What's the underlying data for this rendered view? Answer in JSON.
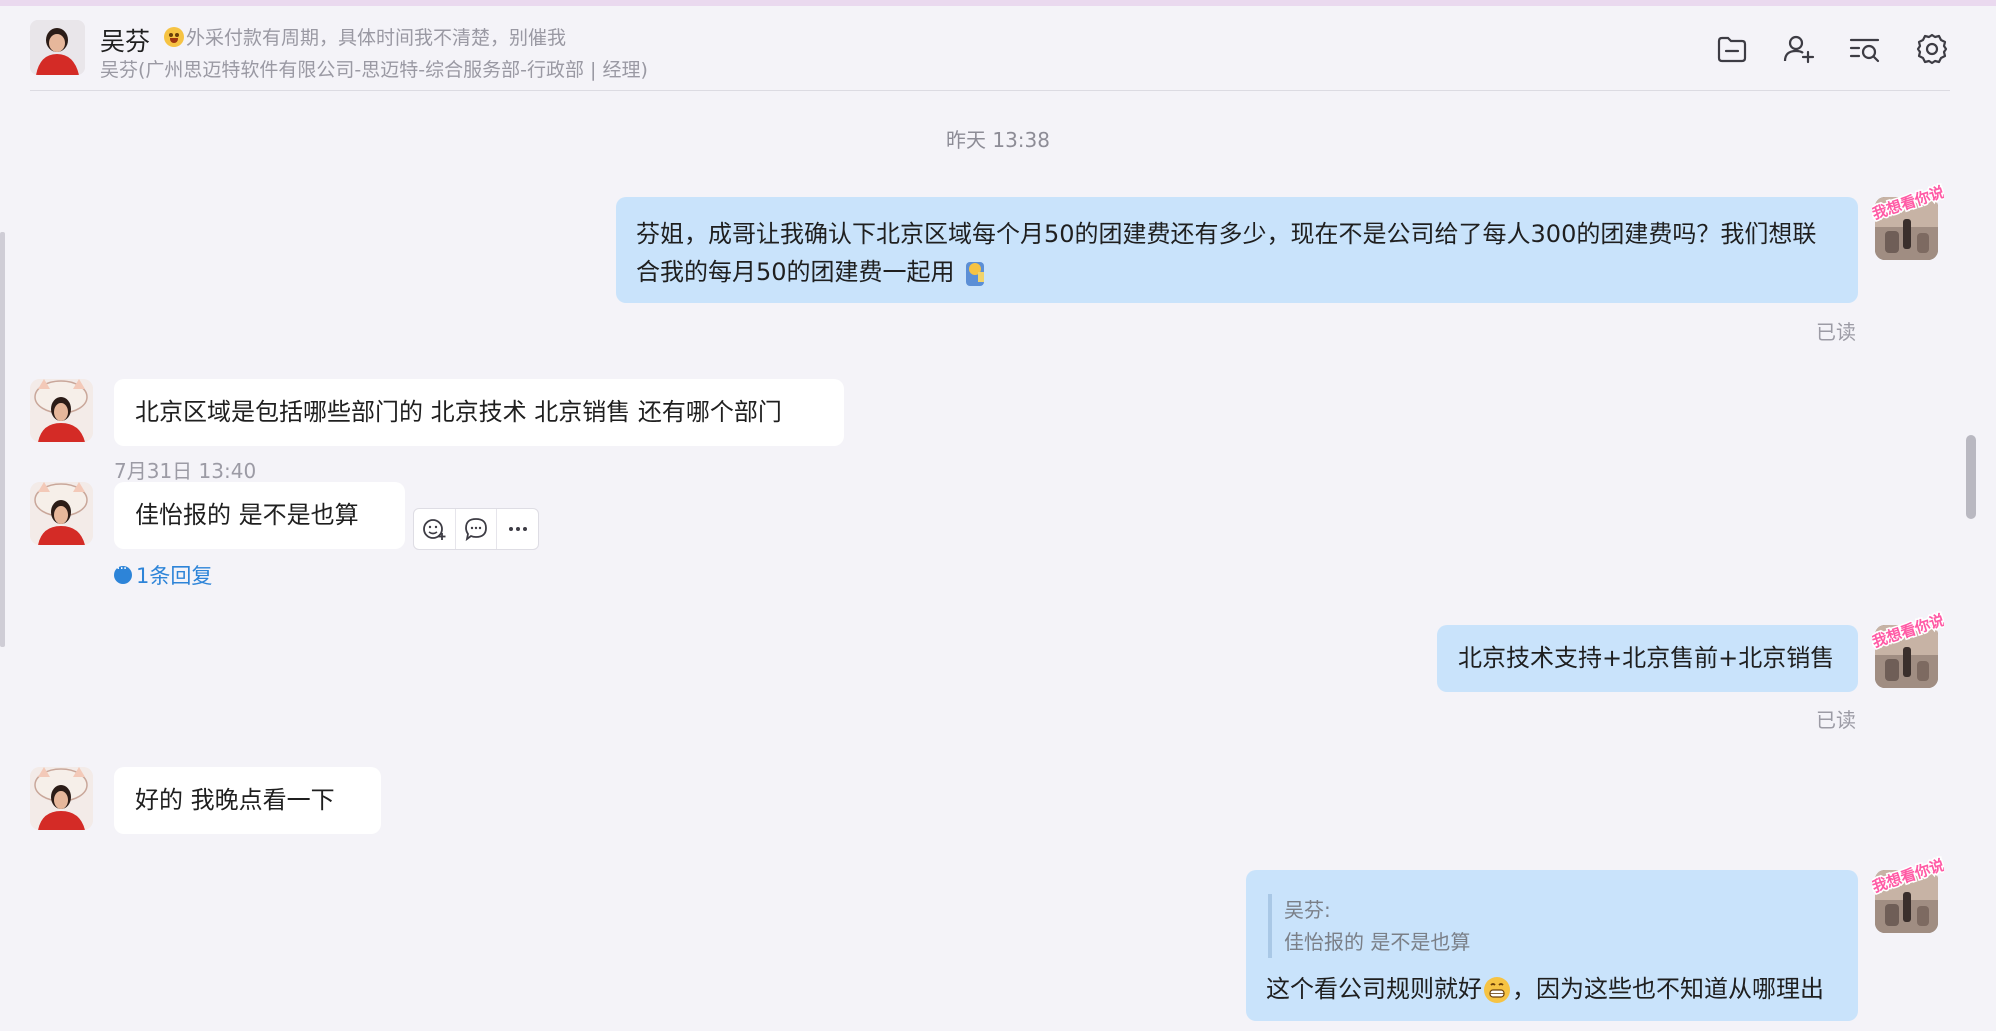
{
  "header": {
    "name": "吴芬",
    "status": "外采付款有周期，具体时间我不清楚，别催我",
    "subtitle": "吴芬(广州思迈特软件有限公司-思迈特-综合服务部-行政部 | 经理)",
    "icons": [
      "folder-icon",
      "add-user-icon",
      "search-history-icon",
      "gear-icon"
    ]
  },
  "chat": {
    "time_separator": "昨天 13:38",
    "messages": [
      {
        "from": "me",
        "text_line1": "芬姐，成哥让我确认下北京区域每个月50的团建费还有多少，现在不是公司给了每人300的团建费吗？我们想联",
        "text_line2": "合我的每月50的团建费一起用",
        "status": "已读"
      },
      {
        "from": "吴芬",
        "text": "北京区域是包括哪些部门的  北京技术  北京销售 还有哪个部门"
      },
      {
        "from": "吴芬",
        "timestamp": "7月31日 13:40",
        "text": "佳怡报的  是不是也算",
        "reply_count": "1条回复"
      },
      {
        "from": "me",
        "text": "北京技术支持+北京售前+北京销售",
        "status": "已读"
      },
      {
        "from": "吴芬",
        "text": "好的  我晚点看一下"
      },
      {
        "from": "me",
        "quote_author": "吴芬:",
        "quote_text": "佳怡报的  是不是也算",
        "text_before": "这个看公司规则就好",
        "text_after": "，因为这些也不知道从哪理出"
      }
    ]
  },
  "my_avatar_badge": "我想看你说",
  "colors": {
    "background": "#f4f3f8",
    "my_bubble": "#c9e3fb",
    "their_bubble": "#ffffff",
    "link": "#2d84d8"
  }
}
